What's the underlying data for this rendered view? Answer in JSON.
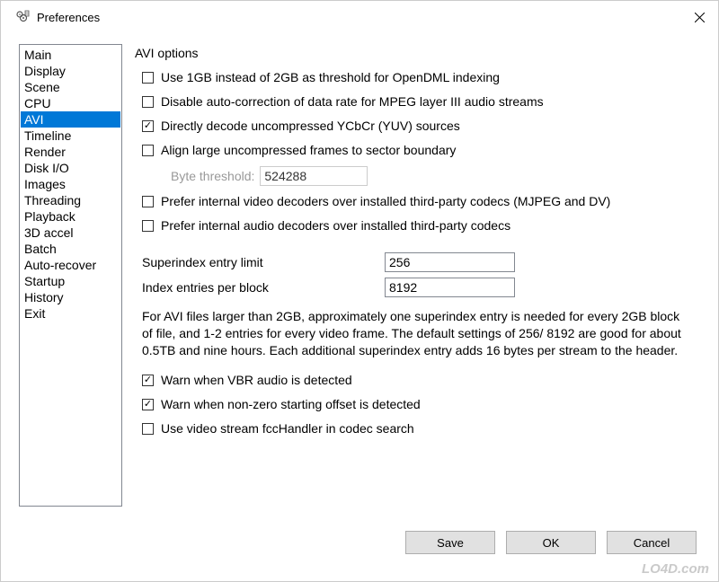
{
  "window": {
    "title": "Preferences"
  },
  "sidebar": {
    "items": [
      {
        "label": "Main",
        "selected": false
      },
      {
        "label": "Display",
        "selected": false
      },
      {
        "label": "Scene",
        "selected": false
      },
      {
        "label": "CPU",
        "selected": false
      },
      {
        "label": "AVI",
        "selected": true
      },
      {
        "label": "Timeline",
        "selected": false
      },
      {
        "label": "Render",
        "selected": false
      },
      {
        "label": "Disk I/O",
        "selected": false
      },
      {
        "label": "Images",
        "selected": false
      },
      {
        "label": "Threading",
        "selected": false
      },
      {
        "label": "Playback",
        "selected": false
      },
      {
        "label": "3D accel",
        "selected": false
      },
      {
        "label": "Batch",
        "selected": false
      },
      {
        "label": "Auto-recover",
        "selected": false
      },
      {
        "label": "Startup",
        "selected": false
      },
      {
        "label": "History",
        "selected": false
      },
      {
        "label": "Exit",
        "selected": false
      }
    ]
  },
  "panel": {
    "group_title": "AVI options",
    "opt1": {
      "label": "Use 1GB instead of 2GB as threshold for OpenDML indexing",
      "checked": false
    },
    "opt2": {
      "label": "Disable auto-correction of data rate for MPEG layer III audio streams",
      "checked": false
    },
    "opt3": {
      "label": "Directly decode uncompressed YCbCr (YUV) sources",
      "checked": true
    },
    "opt4": {
      "label": "Align large uncompressed frames to sector boundary",
      "checked": false
    },
    "byte_threshold_label": "Byte threshold:",
    "byte_threshold_value": "524288",
    "opt5": {
      "label": "Prefer internal video decoders over installed third-party codecs (MJPEG and DV)",
      "checked": false
    },
    "opt6": {
      "label": "Prefer internal audio decoders over installed third-party codecs",
      "checked": false
    },
    "super_label": "Superindex entry limit",
    "super_value": "256",
    "block_label": "Index entries per block",
    "block_value": "8192",
    "info_text": "For AVI files larger than 2GB, approximately one superindex entry is needed for every 2GB block of file, and 1-2 entries for every video frame. The default settings of 256/ 8192 are good for about 0.5TB and nine hours. Each additional superindex entry adds 16 bytes per stream to the header.",
    "opt7": {
      "label": "Warn when VBR audio is detected",
      "checked": true
    },
    "opt8": {
      "label": "Warn when non-zero starting offset is detected",
      "checked": true
    },
    "opt9": {
      "label": "Use video stream fccHandler in codec search",
      "checked": false
    }
  },
  "buttons": {
    "save": "Save",
    "ok": "OK",
    "cancel": "Cancel"
  },
  "watermark": "LO4D.com"
}
